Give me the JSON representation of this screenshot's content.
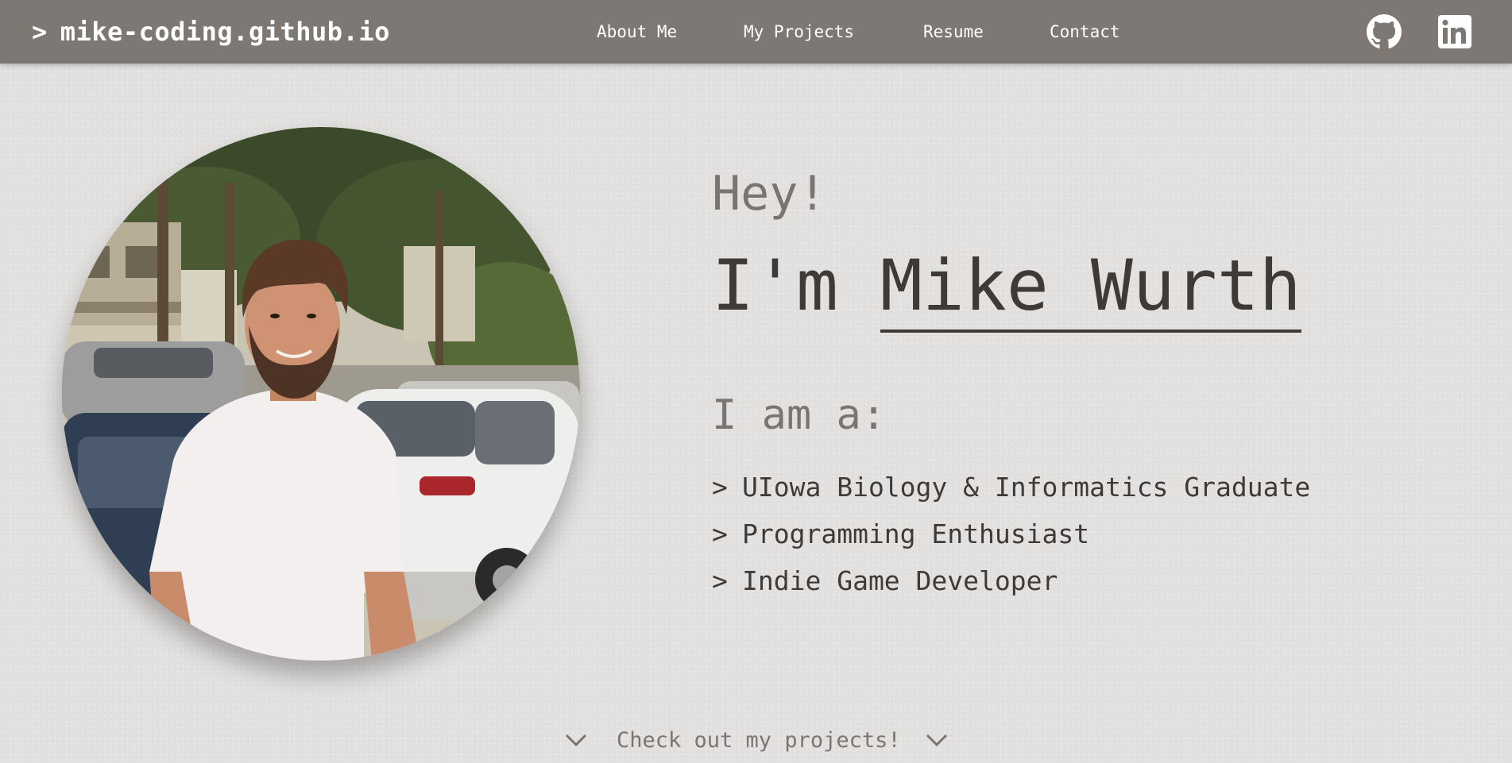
{
  "nav": {
    "brand_prefix": ">",
    "brand": "mike-coding.github.io",
    "links": [
      {
        "label": "About Me"
      },
      {
        "label": "My Projects"
      },
      {
        "label": "Resume"
      },
      {
        "label": "Contact"
      }
    ],
    "social": [
      {
        "icon": "github-icon"
      },
      {
        "icon": "linkedin-icon"
      }
    ]
  },
  "hero": {
    "greeting": "Hey!",
    "intro_prefix": "I'm ",
    "name": "Mike Wurth",
    "iam": "I am a:",
    "bullet": ">",
    "traits": [
      "UIowa Biology & Informatics Graduate",
      "Programming Enthusiast",
      "Indie Game Developer"
    ],
    "photo_icon": "profile-photo"
  },
  "cta": {
    "label": "Check out my projects!",
    "icon": "chevron-down-icon"
  },
  "colors": {
    "navbar": "#7d7874",
    "background": "#e3e1df",
    "text_dark": "#3e3a38",
    "text_muted": "#7a7572",
    "nav_text": "#ffffff"
  }
}
